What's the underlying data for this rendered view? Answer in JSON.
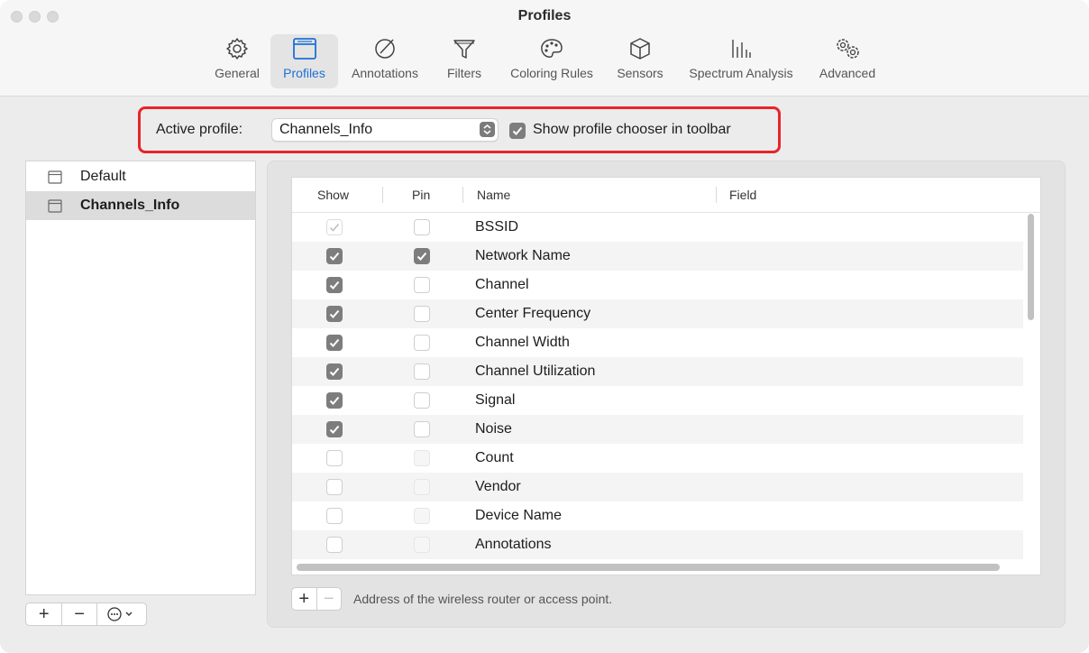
{
  "window": {
    "title": "Profiles"
  },
  "toolbar": {
    "items": [
      {
        "label": "General",
        "icon": "gear-icon"
      },
      {
        "label": "Profiles",
        "icon": "profile-window-icon",
        "active": true
      },
      {
        "label": "Annotations",
        "icon": "annotation-pencil-icon"
      },
      {
        "label": "Filters",
        "icon": "funnel-icon"
      },
      {
        "label": "Coloring Rules",
        "icon": "palette-icon"
      },
      {
        "label": "Sensors",
        "icon": "cube-icon"
      },
      {
        "label": "Spectrum Analysis",
        "icon": "spectrum-bars-icon"
      },
      {
        "label": "Advanced",
        "icon": "double-gear-icon"
      }
    ]
  },
  "active_profile": {
    "label": "Active profile:",
    "value": "Channels_Info",
    "show_chooser_label": "Show profile chooser in toolbar",
    "show_chooser_checked": true
  },
  "profiles": [
    {
      "name": "Default",
      "selected": false
    },
    {
      "name": "Channels_Info",
      "selected": true
    }
  ],
  "table": {
    "headers": {
      "show": "Show",
      "pin": "Pin",
      "name": "Name",
      "field": "Field"
    },
    "rows": [
      {
        "name": "BSSID",
        "show": true,
        "show_disabled": true,
        "pin": false
      },
      {
        "name": "Network Name",
        "show": true,
        "pin": true
      },
      {
        "name": "Channel",
        "show": true,
        "pin": false
      },
      {
        "name": "Center Frequency",
        "show": true,
        "pin": false
      },
      {
        "name": "Channel Width",
        "show": true,
        "pin": false
      },
      {
        "name": "Channel Utilization",
        "show": true,
        "pin": false
      },
      {
        "name": "Signal",
        "show": true,
        "pin": false
      },
      {
        "name": "Noise",
        "show": true,
        "pin": false
      },
      {
        "name": "Count",
        "show": false,
        "pin": false
      },
      {
        "name": "Vendor",
        "show": false,
        "pin": false
      },
      {
        "name": "Device Name",
        "show": false,
        "pin": false
      },
      {
        "name": "Annotations",
        "show": false,
        "pin": false
      }
    ]
  },
  "description": "Address of the wireless router or access point.",
  "colors": {
    "accent": "#1f6fd6",
    "highlight": "#e8242a",
    "checkbox": "#7d7d7d"
  }
}
